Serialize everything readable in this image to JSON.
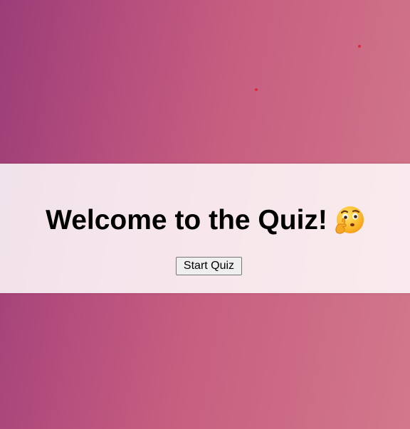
{
  "quiz": {
    "title": "Welcome to the Quiz!",
    "title_emoji": "thinking-face-icon",
    "start_button_label": "Start Quiz"
  },
  "colors": {
    "background_start": "#9b3d78",
    "background_end": "#d2788c",
    "dot_color": "#e0263a",
    "band_background": "#f7eaef"
  }
}
